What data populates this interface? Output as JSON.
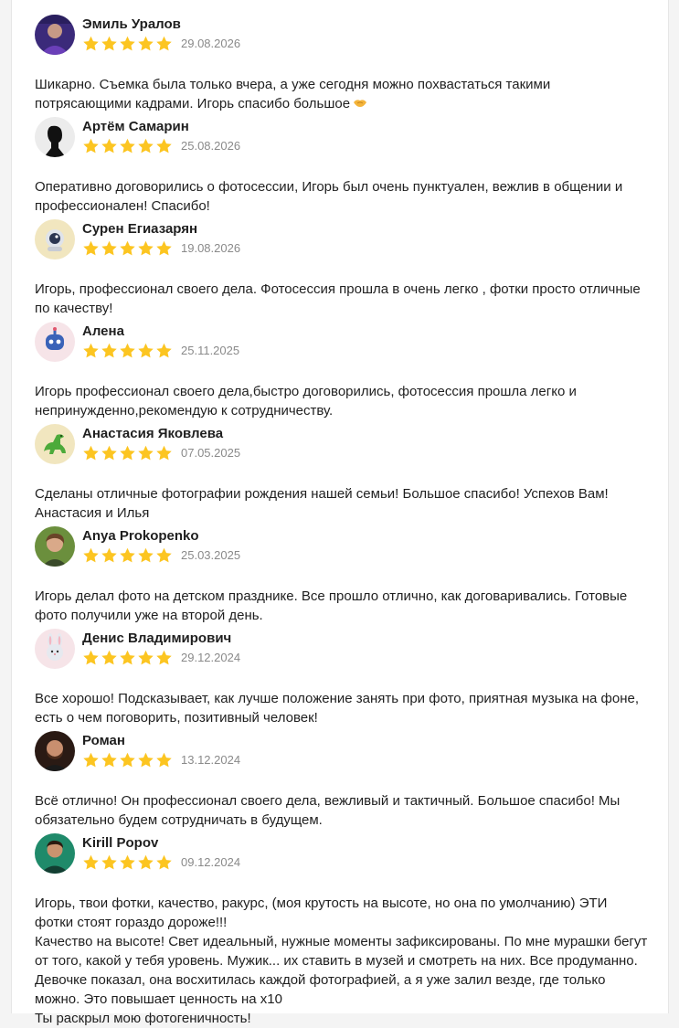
{
  "reviews": [
    {
      "author": "Эмиль Уралов",
      "rating": 5,
      "date": "29.08.2026",
      "text": "Шикарно. Съемка была только вчера, а уже сегодня можно похвастаться такими\nпотрясающими кадрами. Игорь спасибо большое",
      "emoji": "handshake-emoji",
      "avatar": "photo-avatar"
    },
    {
      "author": "Артём Самарин",
      "rating": 5,
      "date": "25.08.2026",
      "text": "Оперативно договорились о фотосессии, Игорь был очень пунктуален, вежлив в общении и\nпрофессионален! Спасибо!",
      "avatar": "profile-silhouette-avatar"
    },
    {
      "author": "Сурен Егиазарян",
      "rating": 5,
      "date": "19.08.2026",
      "text": "Игорь, профессионал своего дела. Фотосессия прошла в очень легко , фотки просто отличные\nпо качеству!",
      "avatar": "astronaut-avatar"
    },
    {
      "author": "Алена",
      "rating": 5,
      "date": "25.11.2025",
      "text": "Игорь профессионал своего дела,быстро договорились, фотосессия прошла легко и\nнепринужденно,рекомендую к сотрудничеству.",
      "avatar": "robot-avatar"
    },
    {
      "author": "Анастасия Яковлева",
      "rating": 5,
      "date": "07.05.2025",
      "text": "Сделаны отличные фотографии рождения нашей семьи! Большое спасибо! Успехов Вам!\nАнастасия и Илья",
      "avatar": "dinosaur-avatar"
    },
    {
      "author": "Anya Prokopenko",
      "rating": 5,
      "date": "25.03.2025",
      "text": "Игорь делал фото на детском празднике. Все прошло отлично, как договаривались. Готовые\nфото получили уже на второй день.",
      "avatar": "photo-avatar"
    },
    {
      "author": "Денис Владимирович",
      "rating": 5,
      "date": "29.12.2024",
      "text": "Все хорошо! Подсказывает, как лучше положение занять при фото, приятная музыка на фоне,\nесть о чем поговорить, позитивный человек!",
      "avatar": "bunny-avatar"
    },
    {
      "author": "Роман",
      "rating": 5,
      "date": "13.12.2024",
      "text": "Всё отлично! Он профессионал своего дела, вежливый и тактичный. Большое спасибо! Мы\nобязательно будем сотрудничать в будущем.",
      "avatar": "photo-avatar"
    },
    {
      "author": "Kirill Popov",
      "rating": 5,
      "date": "09.12.2024",
      "text": "Игорь, твои фотки, качество, ракурс, (моя крутость на высоте, но она по умолчанию) ЭТИ\nфотки стоят гораздо дороже!!!\nКачество на высоте! Свет идеальный, нужные моменты зафиксированы. По мне мурашки бегут\nот того, какой у тебя уровень. Мужик... их ставить в музей и смотреть на них. Все продуманно.\nДевочке показал, она восхитилась каждой фотографией, а я уже залил везде, где только\nможно. Это повышает ценность на х10\nТы раскрыл мою фотогеничность!",
      "avatar": "photo-avatar"
    }
  ],
  "colors": {
    "star": "#fcc521",
    "date": "#8a8a8a",
    "text": "#1f1f1f"
  }
}
